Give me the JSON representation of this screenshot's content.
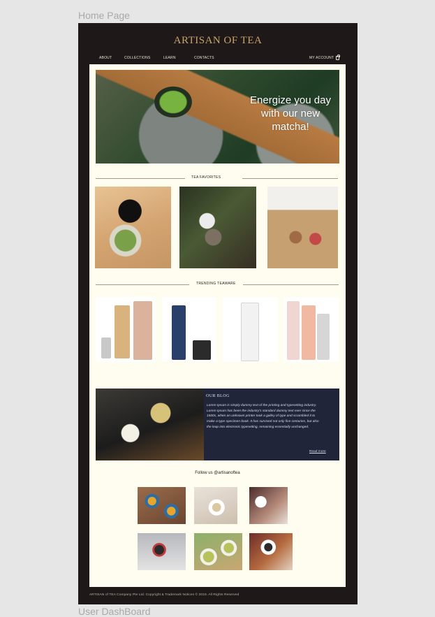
{
  "canvas": {
    "top_label": "Home Page",
    "bottom_label": "User DashBoard"
  },
  "header": {
    "brand": "ARTISAN OF TEA",
    "nav": [
      "ABOUT",
      "COLLECTIONS",
      "LEARN",
      "CONTACTS"
    ],
    "account": "MY ACCOUNT",
    "bag_icon": "shopping-bag-icon"
  },
  "hero": {
    "headline": "Energize you day with our new matcha!"
  },
  "favorites": {
    "title": "TEA FAVORITES"
  },
  "teaware": {
    "title": "TRENDING TEAWARE"
  },
  "blog": {
    "title": "OUR BLOG",
    "body": "Lorem Ipsum is simply dummy text of the printing and typesetting industry. Lorem Ipsum has been the industry's standard dummy text ever since the 1500s, when an unknown printer took a galley of type and scrambled it to make a type specimen book. It has survived not only five centuries, but also the leap into electronic typesetting, remaining essentially unchanged.",
    "read_more": "Read more"
  },
  "instagram": {
    "title": "Follow us @artisanoftea"
  },
  "footer": {
    "text": "ARTISAN of TEA Company Pte Ltd. Copyright & Trademark Notices  © 2019. All Rights Reserved"
  },
  "colors": {
    "frame": "#1e1818",
    "content": "#fefdf0",
    "brand": "#c9a56b",
    "blog_panel": "#21253a"
  }
}
